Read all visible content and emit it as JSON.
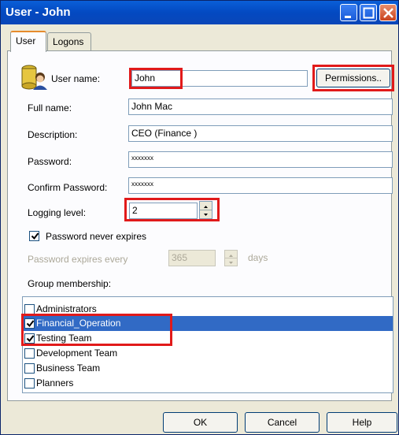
{
  "window": {
    "title": "User - John"
  },
  "tabs": [
    {
      "label": "User"
    },
    {
      "label": "Logons"
    }
  ],
  "form": {
    "username_label": "User name:",
    "username_value": "John",
    "permissions_label": "Permissions..",
    "fullname_label": "Full name:",
    "fullname_value": "John Mac",
    "description_label": "Description:",
    "description_value": "CEO (Finance )",
    "password_label": "Password:",
    "password_value": "xxxxxxx",
    "confirm_label": "Confirm Password:",
    "confirm_value": "xxxxxxx",
    "logging_label": "Logging level:",
    "logging_value": "2",
    "never_expires_label": "Password never expires",
    "never_expires_checked": true,
    "expires_every_label": "Password expires every",
    "expires_every_value": "365",
    "days_label": "days",
    "group_label": "Group membership:"
  },
  "groups": [
    {
      "name": "Administrators",
      "checked": false,
      "selected": false
    },
    {
      "name": "Financial_Operation",
      "checked": true,
      "selected": true
    },
    {
      "name": "Testing Team",
      "checked": true,
      "selected": false
    },
    {
      "name": "Development Team",
      "checked": false,
      "selected": false
    },
    {
      "name": "Business Team",
      "checked": false,
      "selected": false
    },
    {
      "name": "Planners",
      "checked": false,
      "selected": false
    }
  ],
  "buttons": {
    "ok": "OK",
    "cancel": "Cancel",
    "help": "Help"
  },
  "colors": {
    "titlebar": "#0349c1",
    "selection": "#316ac5",
    "highlight_box": "#e11a1a",
    "dialog_bg": "#ece9d8"
  }
}
